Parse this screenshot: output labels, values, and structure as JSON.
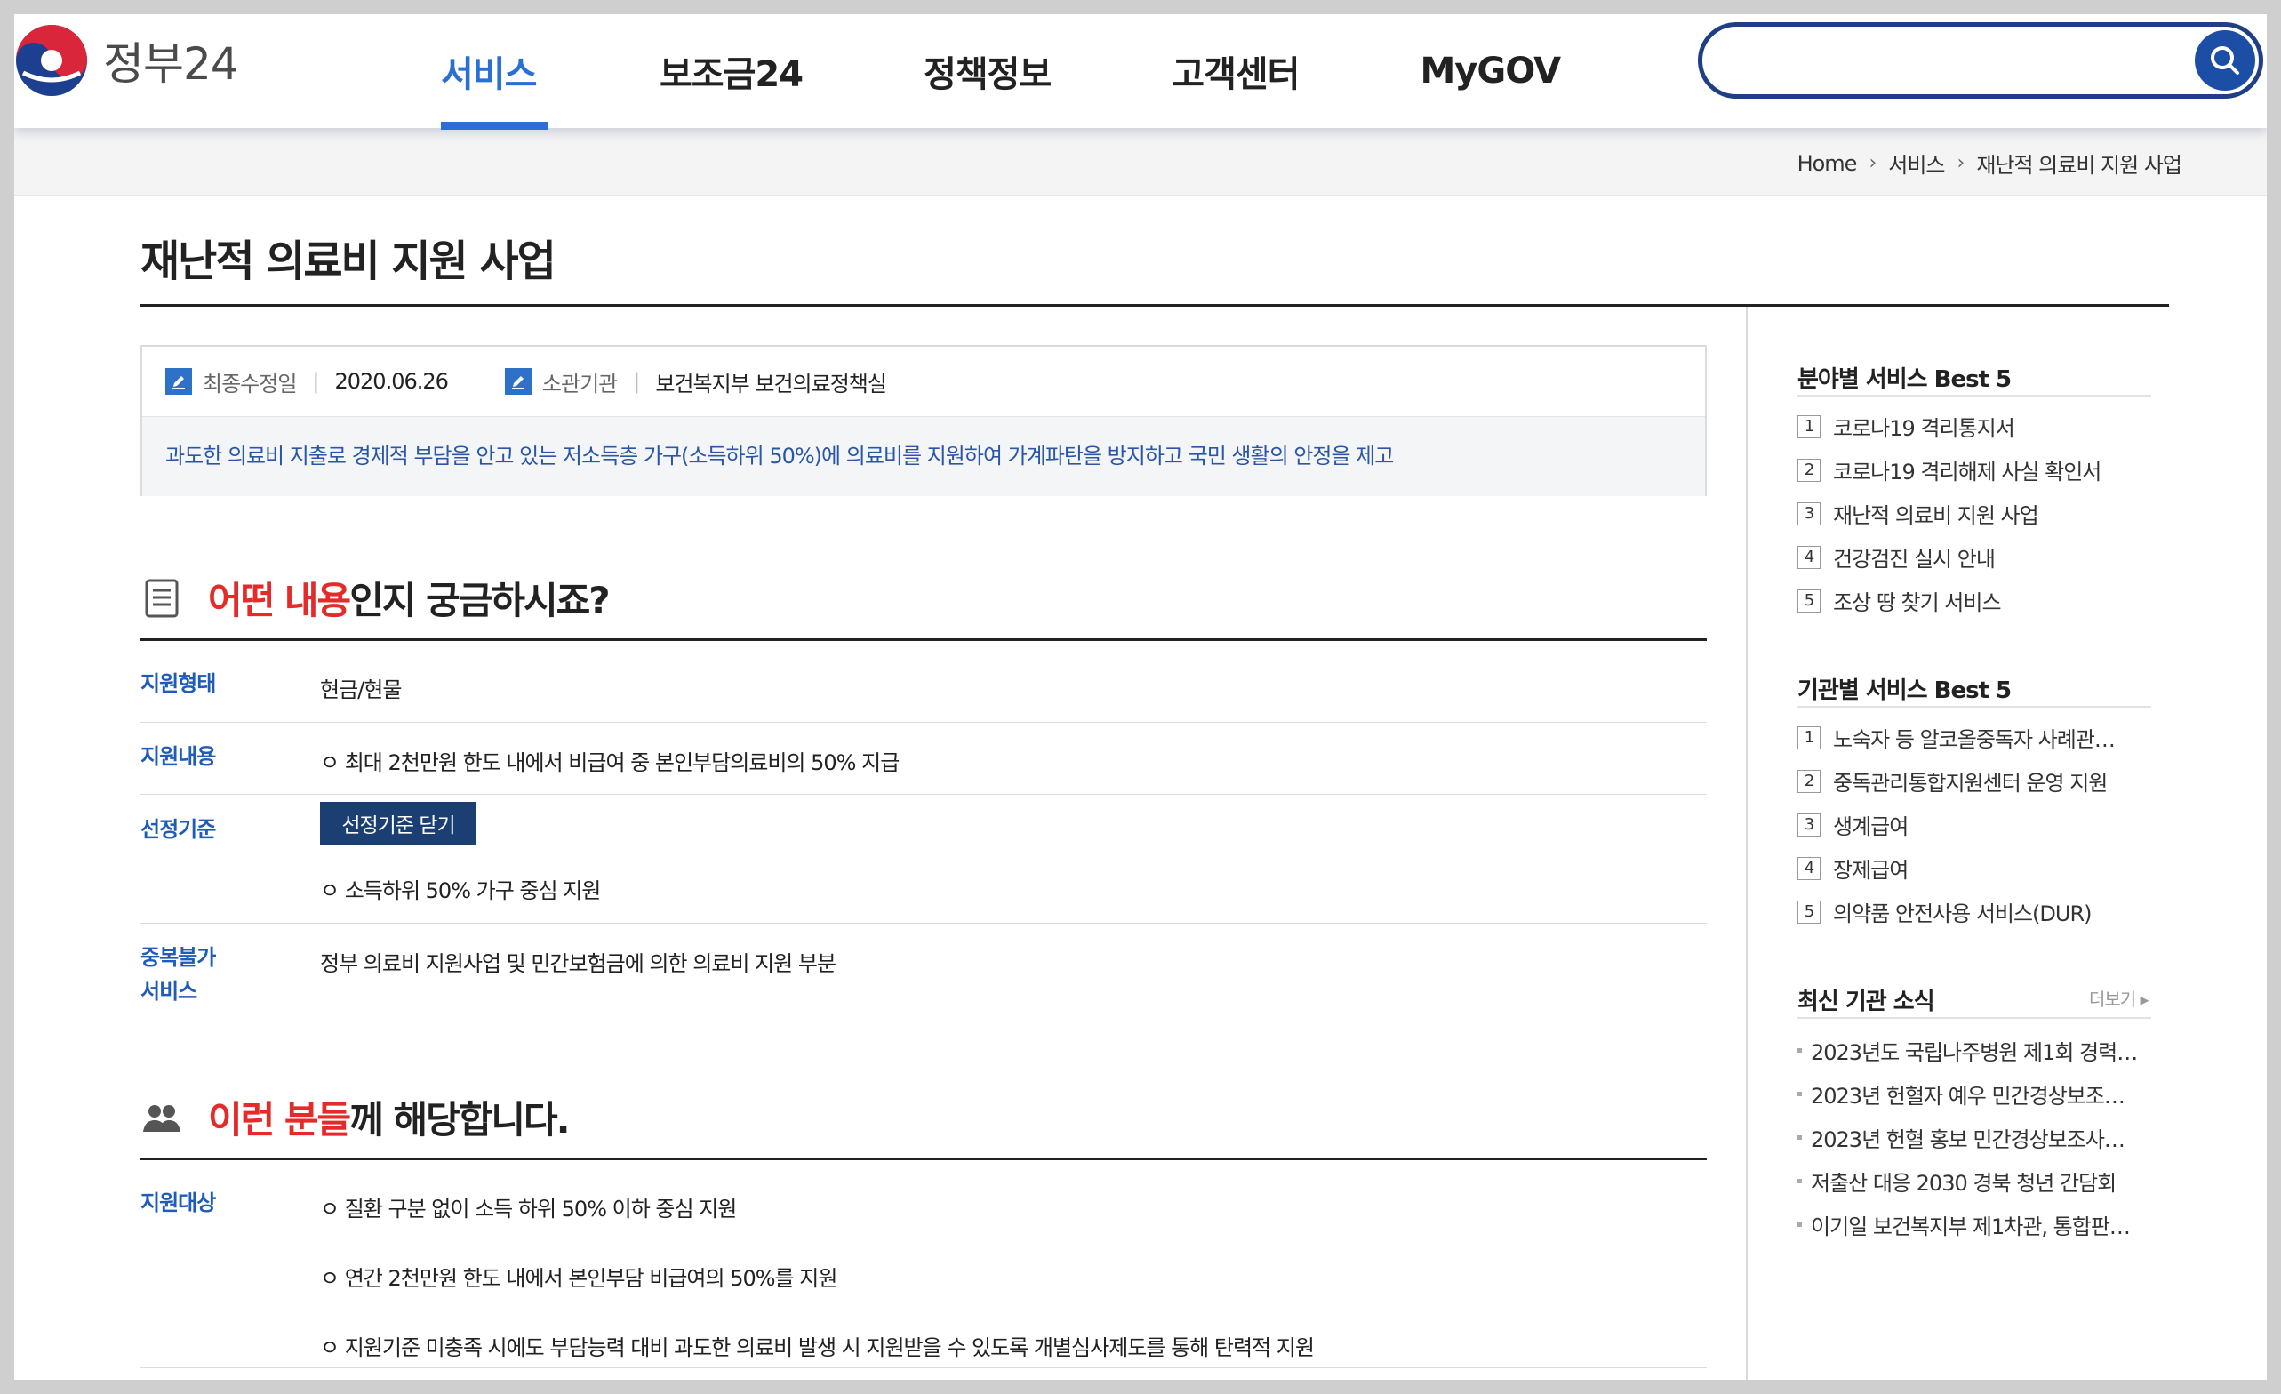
{
  "header": {
    "logo_text": "정부24",
    "nav": [
      {
        "label": "서비스",
        "active": true
      },
      {
        "label": "보조금24",
        "active": false
      },
      {
        "label": "정책정보",
        "active": false
      },
      {
        "label": "고객센터",
        "active": false
      },
      {
        "label": "MyGOV",
        "active": false
      }
    ],
    "search": {
      "placeholder": "",
      "value": ""
    }
  },
  "breadcrumb": [
    "Home",
    "서비스",
    "재난적 의료비 지원 사업"
  ],
  "page_title": "재난적 의료비 지원 사업",
  "info": {
    "updated_label": "최종수정일",
    "updated_value": "2020.06.26",
    "agency_label": "소관기관",
    "agency_value": "보건복지부 보건의료정책실",
    "description": "과도한 의료비 지출로 경제적 부담을 안고 있는 저소득층 가구(소득하위 50%)에 의료비를 지원하여 가계파탄을 방지하고 국민 생활의 안정을 제고"
  },
  "section_content": {
    "title_highlight": "어떤 내용",
    "title_rest": "인지 궁금하시죠?",
    "rows": [
      {
        "label": "지원형태",
        "text": "현금/현물"
      },
      {
        "label": "지원내용",
        "text": "ㅇ 최대 2천만원 한도 내에서 비급여 중 본인부담의료비의 50% 지급"
      },
      {
        "label": "선정기준",
        "button": "선정기준 닫기",
        "text": "ㅇ 소득하위 50% 가구 중심 지원"
      },
      {
        "label_line1": "중복불가",
        "label_line2": "서비스",
        "text": "정부 의료비 지원사업 및 민간보험금에 의한 의료비 지원 부분"
      }
    ]
  },
  "section_target": {
    "title_highlight": "이런 분들",
    "title_rest": "께 해당합니다.",
    "label": "지원대상",
    "items": [
      "ㅇ 질환 구분 없이 소득 하위 50% 이하 중심 지원",
      "ㅇ 연간 2천만원 한도 내에서 본인부담 비급여의 50%를 지원",
      "ㅇ 지원기준 미충족 시에도 부담능력 대비 과도한 의료비 발생 시 지원받을 수 있도록 개별심사제도를 통해 탄력적 지원"
    ]
  },
  "sidebar": {
    "field_best": {
      "title": "분야별 서비스 Best 5",
      "items": [
        {
          "rank": "1",
          "label": "코로나19 격리통지서"
        },
        {
          "rank": "2",
          "label": "코로나19 격리해제 사실 확인서"
        },
        {
          "rank": "3",
          "label": "재난적 의료비 지원 사업"
        },
        {
          "rank": "4",
          "label": "건강검진 실시 안내"
        },
        {
          "rank": "5",
          "label": "조상 땅 찾기 서비스"
        }
      ]
    },
    "agency_best": {
      "title": "기관별 서비스 Best 5",
      "items": [
        {
          "rank": "1",
          "label": "노숙자 등 알코올중독자 사례관…"
        },
        {
          "rank": "2",
          "label": "중독관리통합지원센터 운영 지원"
        },
        {
          "rank": "3",
          "label": "생계급여"
        },
        {
          "rank": "4",
          "label": "장제급여"
        },
        {
          "rank": "5",
          "label": "의약품 안전사용 서비스(DUR)"
        }
      ]
    },
    "news": {
      "title": "최신 기관 소식",
      "more": "더보기 ▸",
      "items": [
        "2023년도 국립나주병원 제1회 경력…",
        "2023년 헌혈자 예우 민간경상보조…",
        "2023년 헌혈 홍보 민간경상보조사…",
        "저출산 대응 2030 경북 청년 간담회",
        "이기일 보건복지부 제1차관, 통합판…"
      ]
    }
  },
  "colors": {
    "accent_blue": "#2a6fd6",
    "navy": "#1f3e86",
    "highlight_red": "#e52a2a",
    "label_blue": "#1f5bb8"
  }
}
